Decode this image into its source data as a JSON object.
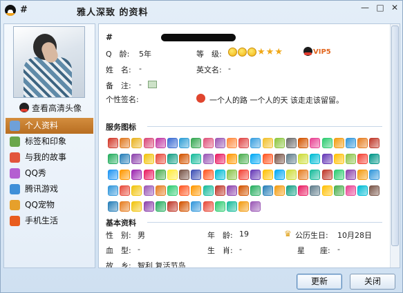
{
  "window": {
    "hash": "#",
    "title": "雅人深致 的资料",
    "controls": {
      "minimize": "—",
      "maximize": "□",
      "close": "✕"
    }
  },
  "sidebar": {
    "hd_avatar_link": "查看高清头像",
    "items": [
      {
        "label": "个人资料",
        "icon": "contact-card-icon",
        "color": "#6fa0d8",
        "active": true
      },
      {
        "label": "标签和印象",
        "icon": "tag-person-icon",
        "color": "#6aa64b",
        "active": false
      },
      {
        "label": "与我的故事",
        "icon": "rainbow-icon",
        "color": "#e2553c",
        "active": false
      },
      {
        "label": "QQ秀",
        "icon": "qq-show-icon",
        "color": "#b45fd1",
        "active": false
      },
      {
        "label": "腾讯游戏",
        "icon": "game-icon",
        "color": "#3f8fd8",
        "active": false
      },
      {
        "label": "QQ宠物",
        "icon": "pet-icon",
        "color": "#e6a02b",
        "active": false
      },
      {
        "label": "手机生活",
        "icon": "mobile-check-icon",
        "color": "#e85c1f",
        "active": false
      }
    ]
  },
  "profile": {
    "hash": "#",
    "q_age_label": "Q　龄:",
    "q_age_value": "5年",
    "level_label": "等　级:",
    "level_smiles": 3,
    "level_stars": 3,
    "vip_label": "VIP5",
    "name_label": "姓　名:",
    "name_value": "-",
    "english_name_label": "英文名:",
    "english_name_value": "-",
    "note_label": "备　注:",
    "note_value": "-",
    "signature_label": "个性签名:",
    "signature_value": "一个人的路  一个人的天 该走走该留留。"
  },
  "service": {
    "title": "服务图标",
    "icon_colors": [
      "#d33b2c",
      "#e07a22",
      "#e9b321",
      "#d94a7a",
      "#c23aa5",
      "#3c6dd3",
      "#2f9fd6",
      "#36a853",
      "#e0567d",
      "#9b59b6",
      "#ff8a3d",
      "#e04848",
      "#3aa0e0",
      "#f2c12e",
      "#8cc63f",
      "#6e6e6e",
      "#d35400",
      "#e84393",
      "#2ecc71",
      "#f39c12",
      "#3498db",
      "#e67e22",
      "#c0392b",
      "#27ae60",
      "#2980b9",
      "#8e44ad",
      "#f1c40f",
      "#e74c3c",
      "#16a085",
      "#d35400",
      "#1abc9c",
      "#9b59b6",
      "#e91e63",
      "#ff9800",
      "#4caf50",
      "#03a9f4",
      "#ff5722",
      "#795548",
      "#607d8b",
      "#cddc39",
      "#00bcd4",
      "#673ab7",
      "#ffc107",
      "#8bc34a",
      "#f44336",
      "#009688",
      "#2196f3",
      "#ff9800",
      "#9c27b0",
      "#e91e63",
      "#4caf50",
      "#ffeb3b",
      "#795548",
      "#3f51b5",
      "#ff5722",
      "#00bcd4",
      "#8bc34a",
      "#f44336",
      "#673ab7",
      "#ffc107",
      "#03a9f4",
      "#cddc39",
      "#e67e22",
      "#1abc9c",
      "#c0392b",
      "#2ecc71",
      "#8e44ad",
      "#f39c12",
      "#3498db",
      "#3498db",
      "#e74c3c",
      "#f1c40f",
      "#9b59b6",
      "#e67e22",
      "#2ecc71",
      "#ff5722",
      "#ff9800",
      "#1abc9c",
      "#c0392b",
      "#8e44ad",
      "#d35400",
      "#27ae60",
      "#2980b9",
      "#f39c12",
      "#16a085",
      "#e91e63",
      "#607d8b",
      "#ffc107",
      "#4caf50",
      "#e84393",
      "#00bcd4",
      "#795548",
      "#2980b9",
      "#e67e22",
      "#f1c40f",
      "#8e44ad",
      "#27ae60",
      "#c0392b",
      "#d35400",
      "#3498db",
      "#e74c3c",
      "#2ecc71",
      "#1abc9c",
      "#f39c12",
      "#9b59b6"
    ]
  },
  "basic": {
    "title": "基本资料",
    "gender_label": "性　别:",
    "gender_value": "男",
    "age_label": "年　龄:",
    "age_value": "19",
    "birthday_label": "公历生日:",
    "birthday_value": "10月28日",
    "blood_label": "血　型:",
    "blood_value": "-",
    "zodiac_label": "生　肖:",
    "zodiac_value": "-",
    "constellation_label": "星　　座:",
    "constellation_value": "-",
    "hometown_label": "故　乡:",
    "hometown_value": "智利 复活节岛"
  },
  "buttons": {
    "refresh": "更新",
    "close": "关闭"
  }
}
